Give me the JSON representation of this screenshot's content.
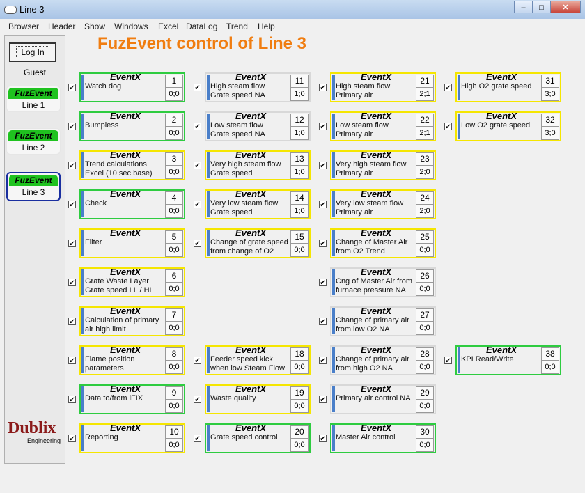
{
  "window": {
    "title": "Line 3"
  },
  "menu": [
    "Browser",
    "Header",
    "Show",
    "Windows",
    "Excel",
    "DataLog",
    "Trend",
    "Help"
  ],
  "sidebar": {
    "login": "Log In",
    "user": "Guest",
    "lines": [
      {
        "top": "FuzEvent",
        "name": "Line 1"
      },
      {
        "top": "FuzEvent",
        "name": "Line 2"
      },
      {
        "top": "FuzEvent",
        "name": "Line 3"
      }
    ],
    "logo": {
      "name": "Dublix",
      "sub": "Engineering"
    }
  },
  "main_title": "FuzEvent control of Line 3",
  "event_label": "EventX",
  "events": [
    {
      "id": "1",
      "desc": "Watch dog",
      "val": "0;0",
      "color": "#2ecc40",
      "checked": true
    },
    {
      "id": "2",
      "desc": "Bumpless",
      "val": "0;0",
      "color": "#2ecc40",
      "checked": true
    },
    {
      "id": "3",
      "desc": "Trend calculations\nExcel  (10 sec base)",
      "val": "0;0",
      "color": "#f5e600",
      "checked": true
    },
    {
      "id": "4",
      "desc": "Check",
      "val": "0;0",
      "color": "#2ecc40",
      "checked": true
    },
    {
      "id": "5",
      "desc": "Filter",
      "val": "0;0",
      "color": "#f5e600",
      "checked": true
    },
    {
      "id": "6",
      "desc": "Grate Waste Layer\nGrate speed LL / HL",
      "val": "0;0",
      "color": "#f5e600",
      "checked": true
    },
    {
      "id": "7",
      "desc": "Calculation of primary\nair high limit",
      "val": "0;0",
      "color": "#f5e600",
      "checked": true
    },
    {
      "id": "8",
      "desc": "Flame position\nparameters",
      "val": "0;0",
      "color": "#f5e600",
      "checked": true
    },
    {
      "id": "9",
      "desc": "Data to/from iFIX",
      "val": "0;0",
      "color": "#2ecc40",
      "checked": true
    },
    {
      "id": "10",
      "desc": "Reporting",
      "val": "0;0",
      "color": "#f5e600",
      "checked": true
    },
    {
      "id": "11",
      "desc": "High steam flow\nGrate speed NA",
      "val": "1;0",
      "color": "#f0f0f0",
      "checked": true
    },
    {
      "id": "12",
      "desc": "Low steam flow\nGrate speed NA",
      "val": "1;0",
      "color": "#f0f0f0",
      "checked": true
    },
    {
      "id": "13",
      "desc": "Very high steam flow\nGrate speed",
      "val": "1;0",
      "color": "#f5e600",
      "checked": true
    },
    {
      "id": "14",
      "desc": "Very low steam flow\nGrate speed",
      "val": "1;0",
      "color": "#f5e600",
      "checked": true
    },
    {
      "id": "15",
      "desc": "Change of grate speed\nfrom change of O2",
      "val": "0;0",
      "color": "#f5e600",
      "checked": true
    },
    {
      "id": "18",
      "desc": "Feeder speed kick\nwhen low Steam Flow",
      "val": "0;0",
      "color": "#f5e600",
      "checked": true
    },
    {
      "id": "19",
      "desc": "Waste quality",
      "val": "0;0",
      "color": "#f5e600",
      "checked": true
    },
    {
      "id": "20",
      "desc": "Grate speed control",
      "val": "0;0",
      "color": "#2ecc40",
      "checked": true
    },
    {
      "id": "21",
      "desc": "High steam flow\nPrimary air",
      "val": "2;1",
      "color": "#f5e600",
      "checked": true
    },
    {
      "id": "22",
      "desc": "Low steam flow\nPrimary air",
      "val": "2;1",
      "color": "#f5e600",
      "checked": true
    },
    {
      "id": "23",
      "desc": "Very high steam flow\nPrimary air",
      "val": "2;0",
      "color": "#f5e600",
      "checked": true
    },
    {
      "id": "24",
      "desc": "Very low steam flow\nPrimary air",
      "val": "2;0",
      "color": "#f5e600",
      "checked": true
    },
    {
      "id": "25",
      "desc": "Change of Master Air\nfrom O2 Trend",
      "val": "0;0",
      "color": "#f5e600",
      "checked": true
    },
    {
      "id": "26",
      "desc": "Cng of Master Air from\nfurnace pressure NA",
      "val": "0;0",
      "color": "#f0f0f0",
      "checked": true
    },
    {
      "id": "27",
      "desc": "Change of primary air\nfrom low O2 NA",
      "val": "0;0",
      "color": "#f0f0f0",
      "checked": true
    },
    {
      "id": "28",
      "desc": "Change of primary air\nfrom high O2 NA",
      "val": "0;0",
      "color": "#f0f0f0",
      "checked": true
    },
    {
      "id": "29",
      "desc": "Primary air control NA",
      "val": "0;0",
      "color": "#f0f0f0",
      "checked": true
    },
    {
      "id": "30",
      "desc": "Master Air control",
      "val": "0;0",
      "color": "#2ecc40",
      "checked": true
    },
    {
      "id": "31",
      "desc": "High O2 grate speed",
      "val": "3;0",
      "color": "#f5e600",
      "checked": true
    },
    {
      "id": "32",
      "desc": "Low O2 grate speed",
      "val": "3;0",
      "color": "#f5e600",
      "checked": true
    },
    {
      "id": "38",
      "desc": "KPI Read/Write",
      "val": "0;0",
      "color": "#2ecc40",
      "checked": true
    }
  ]
}
